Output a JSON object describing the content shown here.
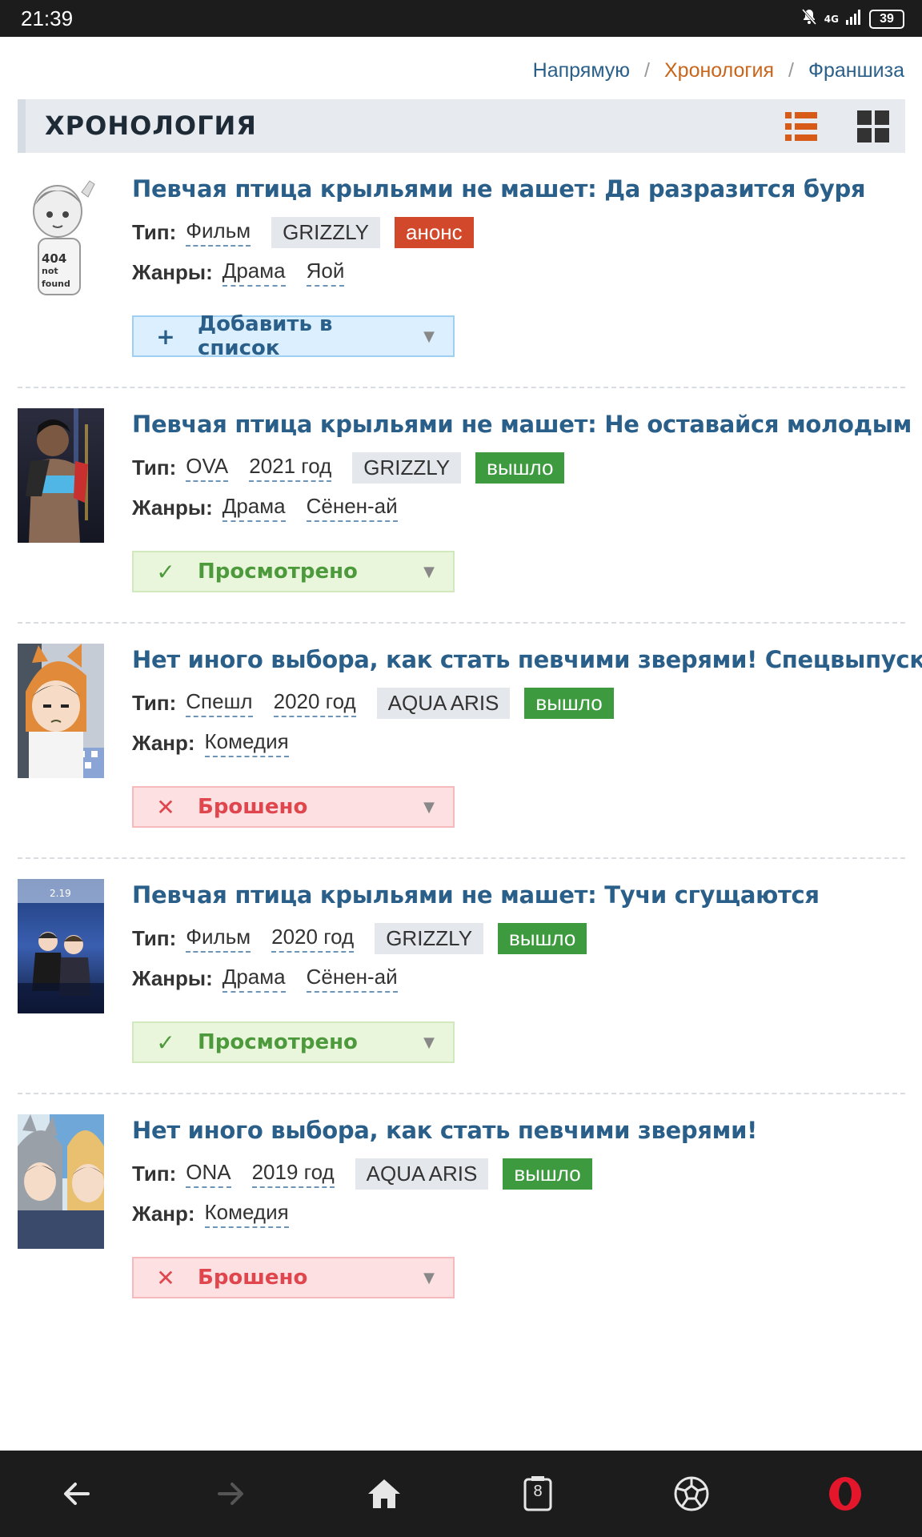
{
  "status_bar": {
    "time": "21:39",
    "network": "4G",
    "battery": "39"
  },
  "tabs": [
    {
      "label": "Напрямую",
      "active": false
    },
    {
      "label": "Хронология",
      "active": true
    },
    {
      "label": "Франшиза",
      "active": false
    }
  ],
  "section": {
    "title": "ХРОНОЛОГИЯ"
  },
  "entries": [
    {
      "title": "Певчая птица крыльями не машет: Да разразится буря",
      "type_label": "Тип:",
      "type": "Фильм",
      "year": "",
      "studio": "GRIZZLY",
      "status": "анонс",
      "status_color": "#d1482a",
      "genres_label": "Жанры:",
      "genres": [
        "Драма",
        "Яой"
      ],
      "list_button": "Добавить в список",
      "list_state": "add",
      "poster_icon": "404-not-found-placeholder"
    },
    {
      "title": "Певчая птица крыльями не машет: Не оставайся молодым",
      "type_label": "Тип:",
      "type": "OVA",
      "year": "2021 год",
      "studio": "GRIZZLY",
      "status": "вышло",
      "status_color": "#3d9a3f",
      "genres_label": "Жанры:",
      "genres": [
        "Драма",
        "Сёнен-ай"
      ],
      "list_button": "Просмотрено",
      "list_state": "watched"
    },
    {
      "title": "Нет иного выбора, как стать певчими зверями! Спецвыпуски",
      "type_label": "Тип:",
      "type": "Спешл",
      "year": "2020 год",
      "studio": "AQUA ARIS",
      "status": "вышло",
      "status_color": "#3d9a3f",
      "genres_label": "Жанр:",
      "genres": [
        "Комедия"
      ],
      "list_button": "Брошено",
      "list_state": "dropped"
    },
    {
      "title": "Певчая птица крыльями не машет: Тучи сгущаются",
      "type_label": "Тип:",
      "type": "Фильм",
      "year": "2020 год",
      "studio": "GRIZZLY",
      "status": "вышло",
      "status_color": "#3d9a3f",
      "genres_label": "Жанры:",
      "genres": [
        "Драма",
        "Сёнен-ай"
      ],
      "list_button": "Просмотрено",
      "list_state": "watched"
    },
    {
      "title": "Нет иного выбора, как стать певчими зверями!",
      "type_label": "Тип:",
      "type": "ONA",
      "year": "2019 год",
      "studio": "AQUA ARIS",
      "status": "вышло",
      "status_color": "#3d9a3f",
      "genres_label": "Жанр:",
      "genres": [
        "Комедия"
      ],
      "list_button": "Брошено",
      "list_state": "dropped"
    }
  ],
  "nav": {
    "tab_count": "8",
    "items": [
      "back-icon",
      "forward-icon",
      "home-icon",
      "tabs-icon",
      "soccer-ball-icon",
      "opera-icon"
    ]
  },
  "colors": {
    "link": "#2a5f8a",
    "active_tab": "#c8651a",
    "announce": "#d1482a",
    "released": "#3d9a3f"
  }
}
